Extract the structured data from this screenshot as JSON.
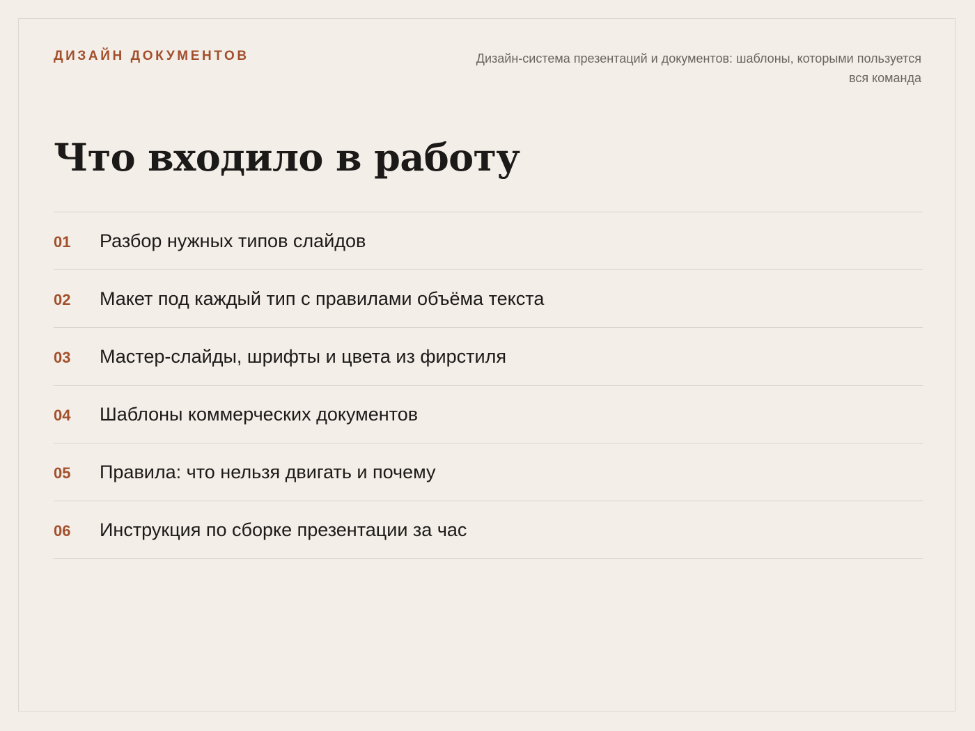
{
  "header": {
    "eyebrow": "ДИЗАЙН ДОКУМЕНТОВ",
    "subtitle": "Дизайн-система презентаций и документов: шаблоны, которыми пользуется вся команда"
  },
  "main": {
    "title": "Что входило в работу",
    "items": [
      {
        "number": "01",
        "text": "Разбор нужных типов слайдов"
      },
      {
        "number": "02",
        "text": "Макет под каждый тип с правилами объёма текста"
      },
      {
        "number": "03",
        "text": "Мастер-слайды, шрифты и цвета из фирстиля"
      },
      {
        "number": "04",
        "text": "Шаблоны коммерческих документов"
      },
      {
        "number": "05",
        "text": "Правила: что нельзя двигать и почему"
      },
      {
        "number": "06",
        "text": "Инструкция по сборке презентации за час"
      }
    ]
  },
  "colors": {
    "accent": "#a24f2c",
    "background": "#f3eee8",
    "text": "#1c1a18",
    "muted": "#6b655f",
    "divider": "#d9d3cc"
  }
}
